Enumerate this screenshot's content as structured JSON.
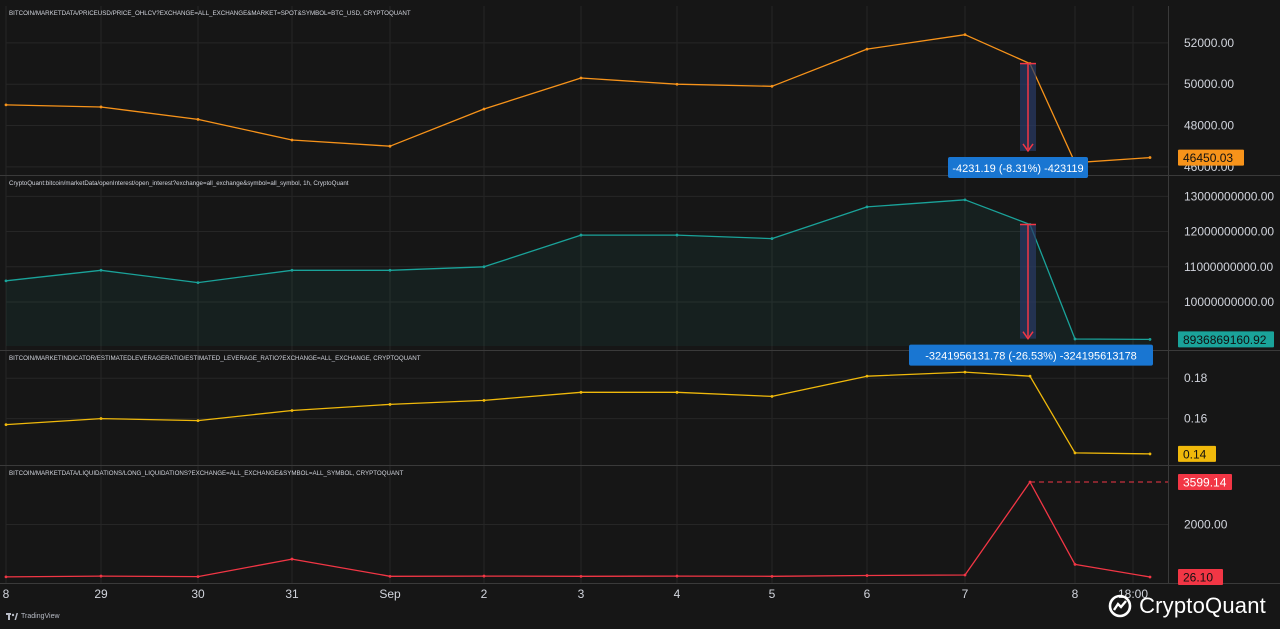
{
  "colors": {
    "background": "#161616",
    "grid": "#262626",
    "divider": "#3a3a3a",
    "text": "#d1d4dc",
    "price": "#f7931a",
    "open_interest": "#1aa39a",
    "leverage": "#f0b90b",
    "liquidations": "#f23645",
    "measure_box": "#1976d2",
    "measure_arrow": "#f23645"
  },
  "x_axis": {
    "ticks": [
      "8",
      "29",
      "30",
      "31",
      "Sep",
      "2",
      "3",
      "4",
      "5",
      "6",
      "7",
      "8",
      "18:00"
    ]
  },
  "branding": {
    "tradingview": "TradingView",
    "cryptoquant": "CryptoQuant"
  },
  "icons": {
    "tradingview": "tradingview-logo-icon",
    "cryptoquant": "cryptoquant-logo-icon"
  },
  "chart_data": [
    {
      "type": "line",
      "title": "BITCOIN/MARKETDATA/PRICEUSD/PRICE_OHLCV?EXCHANGE=ALL_EXCHANGE&MARKET=SPOT&SYMBOL=BTC_USD, CRYPTOQUANT",
      "series": [
        {
          "color": "#f7931a",
          "x": [
            "Aug 28",
            "Aug 29",
            "Aug 30",
            "Aug 31",
            "Sep 1",
            "Sep 2",
            "Sep 3",
            "Sep 4",
            "Sep 5",
            "Sep 6",
            "Sep 7",
            "Sep 7 18:00",
            "Sep 8",
            "Sep 8 18:00"
          ],
          "values": [
            49000,
            48900,
            48300,
            47300,
            47000,
            48800,
            50300,
            50000,
            49900,
            51700,
            52400,
            51000,
            46200,
            46450
          ]
        }
      ],
      "ylim": [
        45800,
        53400
      ],
      "y_ticks": [
        "52000.00",
        "50000.00",
        "48000.00",
        "46000.00"
      ],
      "last_value_label": "46450.03",
      "measurement": {
        "label": "-4231.19 (-8.31%) -423119",
        "from": 51000,
        "to": 46770
      }
    },
    {
      "type": "area",
      "title": "CryptoQuant:bitcoin/marketData/openInterest/open_interest?exchange=all_exchange&symbol=all_symbol, 1h, CryptoQuant",
      "series": [
        {
          "color": "#1aa39a",
          "x": [
            "Aug 28",
            "Aug 29",
            "Aug 30",
            "Aug 31",
            "Sep 1",
            "Sep 2",
            "Sep 3",
            "Sep 4",
            "Sep 5",
            "Sep 6",
            "Sep 7",
            "Sep 7 18:00",
            "Sep 8",
            "Sep 8 18:00"
          ],
          "values": [
            10600000000,
            10900000000,
            10550000000,
            10900000000,
            10900000000,
            11000000000,
            11900000000,
            11900000000,
            11800000000,
            12700000000,
            12900000000,
            12200000000,
            8950000000,
            8936869160.92
          ]
        }
      ],
      "ylim": [
        8750000000,
        13350000000
      ],
      "y_ticks": [
        "13000000000.00",
        "12000000000.00",
        "11000000000.00",
        "10000000000.00"
      ],
      "last_value_label": "8936869160.92",
      "measurement": {
        "label": "-3241956131.78 (-26.53%) -324195613178",
        "from": 12200000000,
        "to": 8958043868
      }
    },
    {
      "type": "line",
      "title": "BITCOIN/MARKETINDICATOR/ESTIMATEDLEVERAGERATIO/ESTIMATED_LEVERAGE_RATIO?EXCHANGE=ALL_EXCHANGE, CRYPTOQUANT",
      "series": [
        {
          "color": "#f0b90b",
          "x": [
            "Aug 28",
            "Aug 29",
            "Aug 30",
            "Aug 31",
            "Sep 1",
            "Sep 2",
            "Sep 3",
            "Sep 4",
            "Sep 5",
            "Sep 6",
            "Sep 7",
            "Sep 7 18:00",
            "Sep 8",
            "Sep 8 18:00"
          ],
          "values": [
            0.157,
            0.16,
            0.159,
            0.164,
            0.167,
            0.169,
            0.173,
            0.173,
            0.171,
            0.181,
            0.183,
            0.181,
            0.143,
            0.1425
          ]
        }
      ],
      "ylim": [
        0.139,
        0.1895
      ],
      "y_ticks": [
        "0.18",
        "0.16"
      ],
      "last_value_label": "0.14"
    },
    {
      "type": "line",
      "title": "BITCOIN/MARKETDATA/LIQUIDATIONS/LONG_LIQUIDATIONS?EXCHANGE=ALL_EXCHANGE&SYMBOL=ALL_SYMBOL, CRYPTOQUANT",
      "series": [
        {
          "color": "#f23645",
          "x": [
            "Aug 28",
            "Aug 29",
            "Aug 30",
            "Aug 31",
            "Sep 1",
            "Sep 2",
            "Sep 3",
            "Sep 4",
            "Sep 5",
            "Sep 6",
            "Sep 7",
            "Sep 7 18:00",
            "Sep 8",
            "Sep 8 18:00"
          ],
          "values": [
            30,
            60,
            40,
            700,
            50,
            60,
            50,
            60,
            50,
            80,
            100,
            3599.14,
            500,
            26.1
          ]
        }
      ],
      "ylim": [
        -50,
        3900
      ],
      "y_ticks": [
        "2000.00"
      ],
      "last_value_label": "26.10",
      "peak_label": "3599.14"
    }
  ]
}
